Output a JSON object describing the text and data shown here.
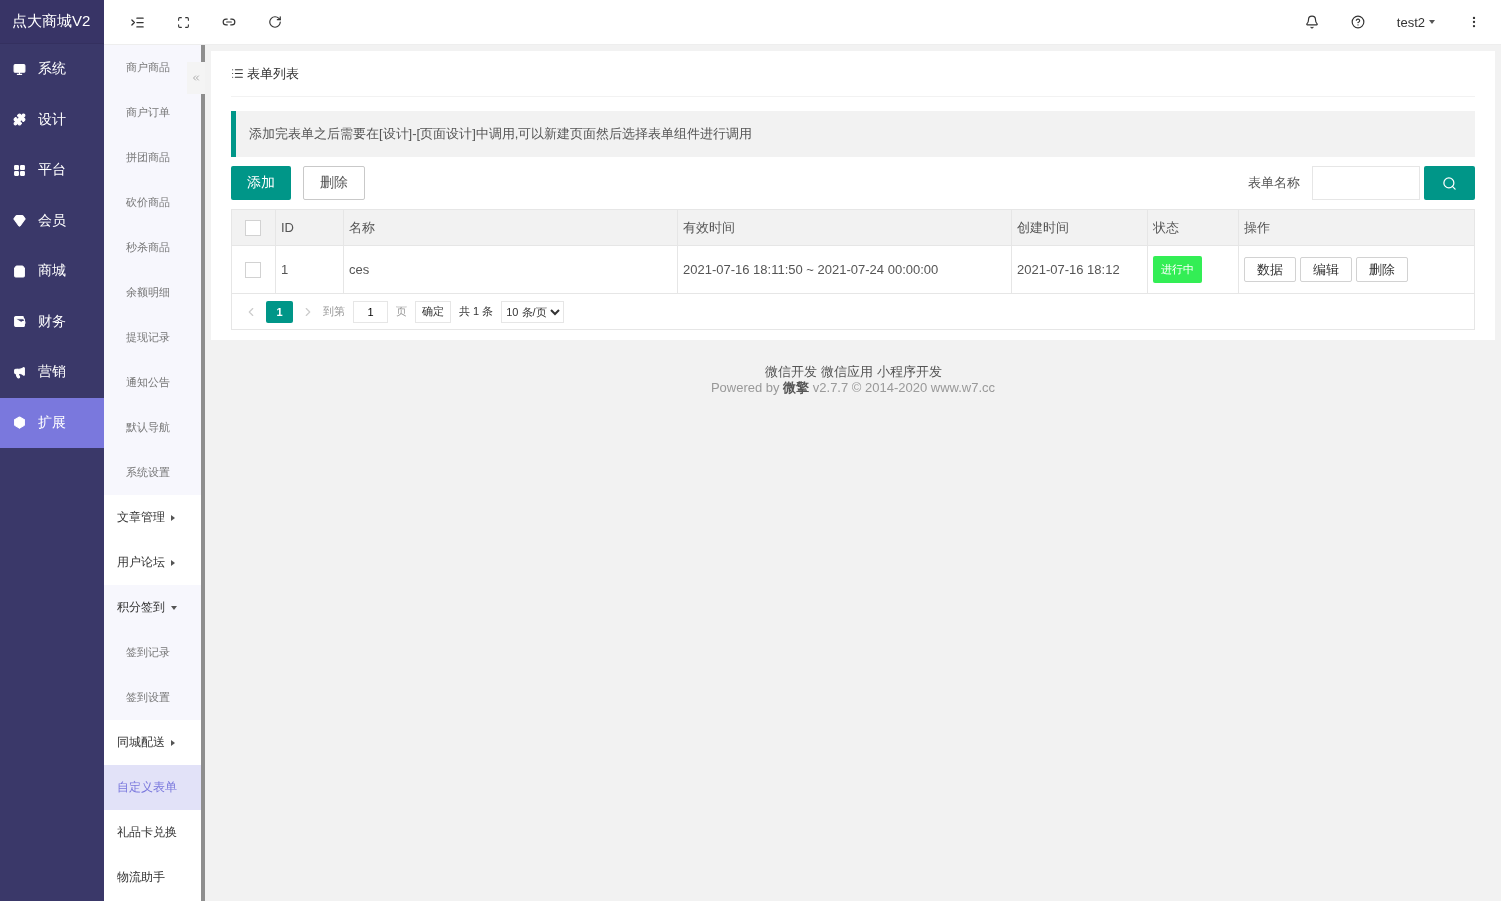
{
  "brand": "点大商城V2",
  "nav": [
    {
      "label": "系统",
      "selected": false
    },
    {
      "label": "设计",
      "selected": false
    },
    {
      "label": "平台",
      "selected": false
    },
    {
      "label": "会员",
      "selected": false
    },
    {
      "label": "商城",
      "selected": false
    },
    {
      "label": "财务",
      "selected": false
    },
    {
      "label": "营销",
      "selected": false
    },
    {
      "label": "扩展",
      "selected": true
    }
  ],
  "submenu": [
    {
      "label": "商户商品",
      "kind": "sub",
      "selected": false
    },
    {
      "label": "商户订单",
      "kind": "sub",
      "selected": false
    },
    {
      "label": "拼团商品",
      "kind": "sub",
      "selected": false
    },
    {
      "label": "砍价商品",
      "kind": "sub",
      "selected": false
    },
    {
      "label": "秒杀商品",
      "kind": "sub",
      "selected": false
    },
    {
      "label": "余额明细",
      "kind": "sub",
      "selected": false
    },
    {
      "label": "提现记录",
      "kind": "sub",
      "selected": false
    },
    {
      "label": "通知公告",
      "kind": "sub",
      "selected": false
    },
    {
      "label": "默认导航",
      "kind": "sub",
      "selected": false
    },
    {
      "label": "系统设置",
      "kind": "sub",
      "selected": false
    },
    {
      "label": "文章管理",
      "kind": "group",
      "expanded": false,
      "selected": false
    },
    {
      "label": "用户论坛",
      "kind": "group",
      "expanded": false,
      "selected": false
    },
    {
      "label": "积分签到",
      "kind": "group",
      "expanded": true,
      "selected": false
    },
    {
      "label": "签到记录",
      "kind": "sub",
      "selected": false
    },
    {
      "label": "签到设置",
      "kind": "sub",
      "selected": false
    },
    {
      "label": "同城配送",
      "kind": "group",
      "expanded": false,
      "selected": false
    },
    {
      "label": "自定义表单",
      "kind": "item",
      "selected": true
    },
    {
      "label": "礼品卡兑换",
      "kind": "item",
      "selected": false
    },
    {
      "label": "物流助手",
      "kind": "item",
      "selected": false
    }
  ],
  "user": "test2",
  "card": {
    "title": "表单列表",
    "notice": "添加完表单之后需要在[设计]-[页面设计]中调用,可以新建页面然后选择表单组件进行调用",
    "add_button": "添加",
    "delete_button": "删除",
    "search_label": "表单名称"
  },
  "table": {
    "all_checked": false,
    "columns": [
      "ID",
      "名称",
      "有效时间",
      "创建时间",
      "状态",
      "操作"
    ],
    "rows": [
      {
        "checked": false,
        "id": "1",
        "name": "ces",
        "valid": "2021-07-16 18:11:50 ~ 2021-07-24 00:00:00",
        "created": "2021-07-16 18:12",
        "status": "进行中",
        "actions": [
          "数据",
          "编辑",
          "删除"
        ]
      }
    ]
  },
  "pagination": {
    "pages": [
      {
        "label": "1",
        "selected": true
      }
    ],
    "goto_label": "到第",
    "goto_value": "1",
    "page_unit": "页",
    "confirm": "确定",
    "total": "共 1 条",
    "page_size": "10 条/页"
  },
  "footer": {
    "links": [
      "微信开发",
      "微信应用",
      "小程序开发"
    ],
    "powered": "Powered by **微擎** v2.7.7 © 2014-2020 www.w7.cc"
  }
}
